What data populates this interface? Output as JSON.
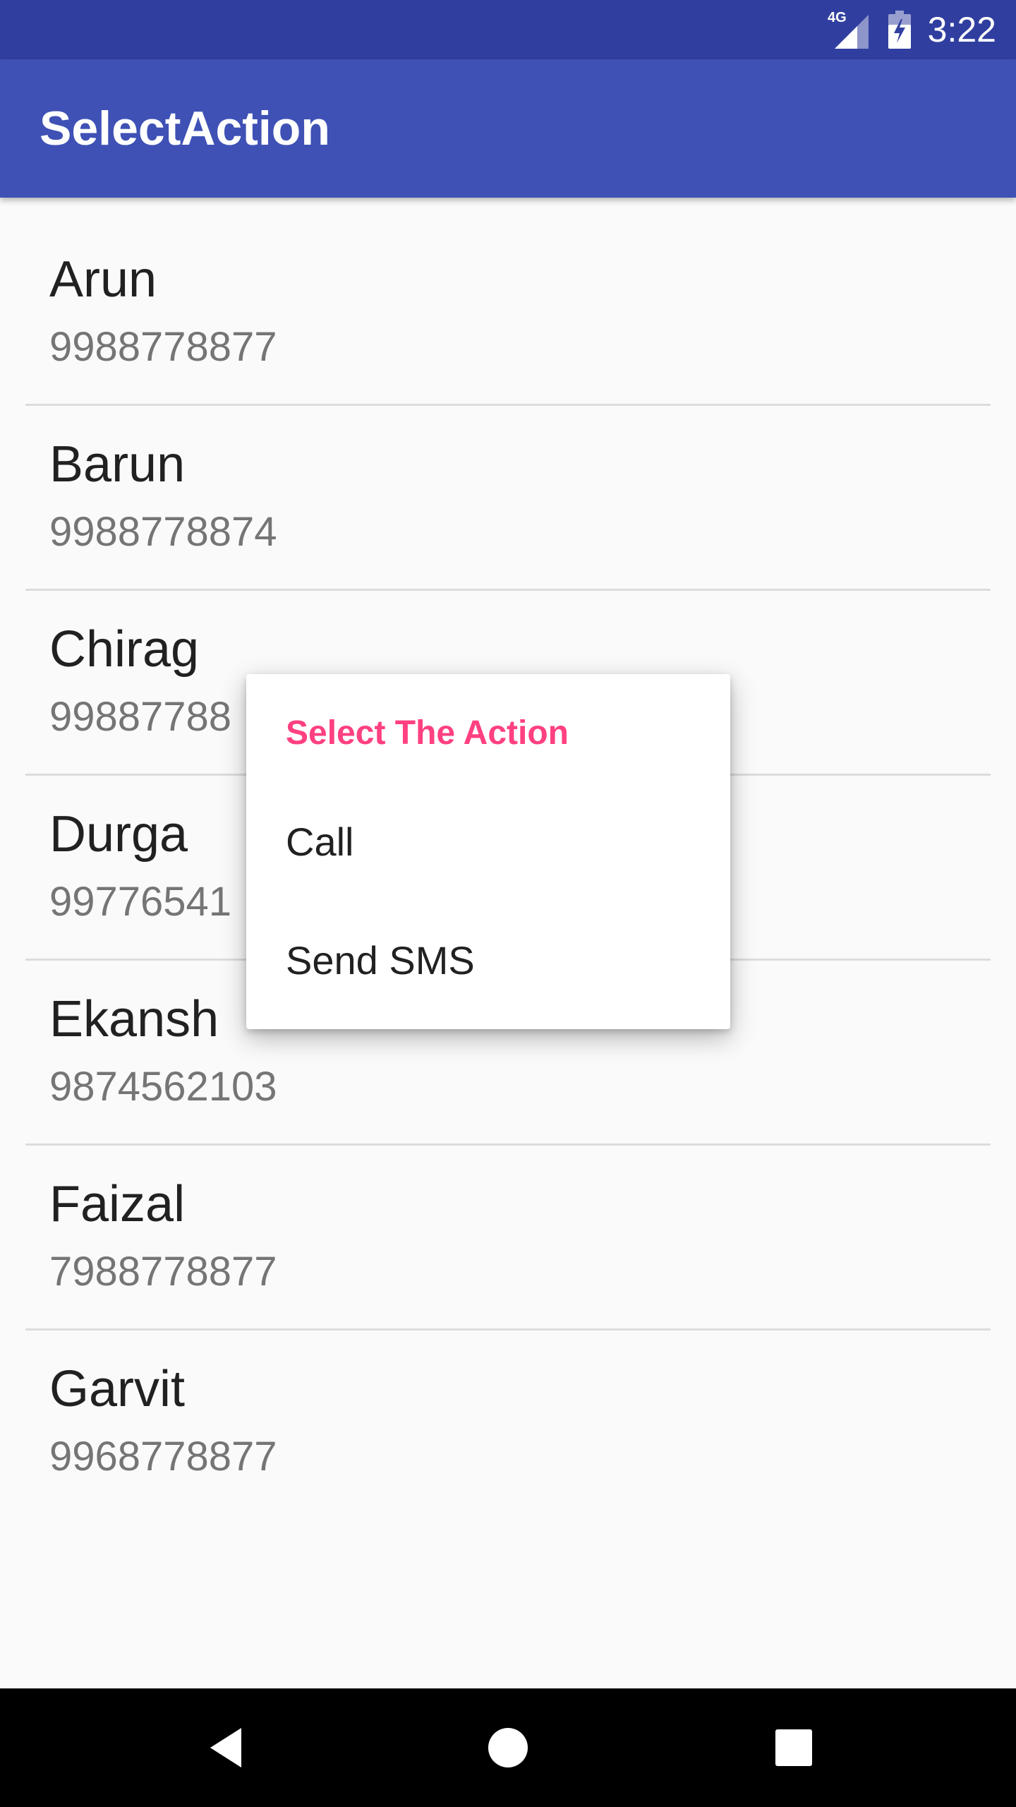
{
  "status_bar": {
    "network": "4G",
    "time": "3:22",
    "icons": [
      "signal-4g-icon",
      "battery-charging-icon"
    ]
  },
  "app_bar": {
    "title": "SelectAction"
  },
  "contacts": [
    {
      "name": "Arun",
      "number": "9988778877"
    },
    {
      "name": "Barun",
      "number": "9988778874"
    },
    {
      "name": "Chirag",
      "number": "99887788"
    },
    {
      "name": "Durga",
      "number": "99776541"
    },
    {
      "name": "Ekansh",
      "number": "9874562103"
    },
    {
      "name": "Faizal",
      "number": "7988778877"
    },
    {
      "name": "Garvit",
      "number": "9968778877"
    }
  ],
  "context_menu": {
    "title": "Select The Action",
    "items": [
      {
        "label": "Call"
      },
      {
        "label": "Send SMS"
      }
    ]
  },
  "nav_bar": {
    "icons": [
      "back-icon",
      "home-icon",
      "recents-icon"
    ]
  },
  "colors": {
    "status_bar": "#303f9f",
    "app_bar": "#3f51b5",
    "accent": "#ff4081",
    "background": "#fafafa"
  }
}
